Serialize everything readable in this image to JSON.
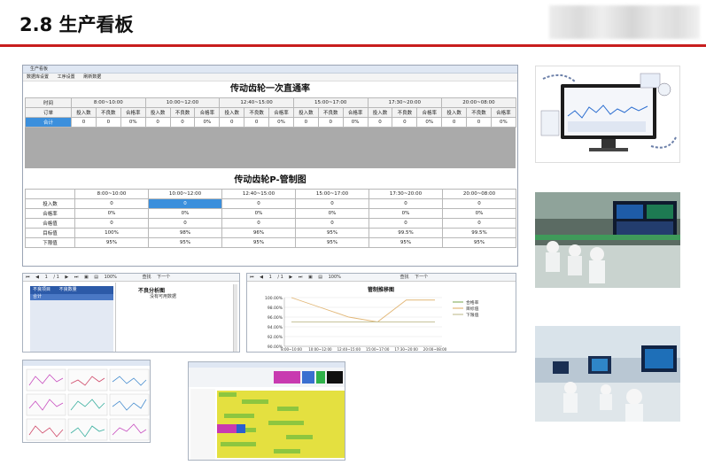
{
  "slide": {
    "title": "2.8 生产看板"
  },
  "app_window": {
    "title": "生产看板",
    "menu": [
      "数据库设置",
      "工序设置",
      "刷新数据"
    ]
  },
  "yield_table": {
    "title": "传动齿轮一次直通率",
    "time_label": "时间",
    "order_label": "订单",
    "total_label": "合计",
    "periods": [
      "8:00~10:00",
      "10:00~12:00",
      "12:40~15:00",
      "15:00~17:00",
      "17:30~20:00",
      "20:00~08:00"
    ],
    "sub_columns": [
      "投入数",
      "不良数",
      "合格率"
    ],
    "total_row": [
      "0",
      "0",
      "0%",
      "0",
      "0",
      "0%",
      "0",
      "0",
      "0%",
      "0",
      "0",
      "0%",
      "0",
      "0",
      "0%",
      "0",
      "0",
      "0%"
    ]
  },
  "p_chart_table": {
    "title": "传动齿轮P-管制图",
    "periods": [
      "8:00~10:00",
      "10:00~12:00",
      "12:40~15:00",
      "15:00~17:00",
      "17:30~20:00",
      "20:00~08:00"
    ],
    "rows": [
      {
        "label": "投入数",
        "values": [
          "0",
          "0",
          "0",
          "0",
          "0",
          "0"
        ]
      },
      {
        "label": "合格率",
        "values": [
          "0%",
          "0%",
          "0%",
          "0%",
          "0%",
          "0%"
        ]
      },
      {
        "label": "合格值",
        "values": [
          "0",
          "0",
          "0",
          "0",
          "0",
          "0"
        ]
      },
      {
        "label": "目标值",
        "values": [
          "100%",
          "98%",
          "96%",
          "95%",
          "99.5%",
          "99.5%"
        ]
      },
      {
        "label": "下限值",
        "values": [
          "95%",
          "95%",
          "95%",
          "95%",
          "95%",
          "95%"
        ]
      }
    ]
  },
  "report_left": {
    "page": "1",
    "pages": "/ 1",
    "zoom": "100%",
    "find": "查找",
    "next": "下一个",
    "col_defect_item": "不良项目",
    "col_defect_count": "不良数量",
    "total_label": "合计",
    "analysis_title": "不良分析图",
    "analysis_empty": "没有可用数据"
  },
  "report_right": {
    "page": "1",
    "pages": "/ 1",
    "zoom": "100%",
    "find": "查找",
    "next": "下一个"
  },
  "chart_data": {
    "type": "line",
    "title": "管制推移图",
    "categories": [
      "8:00~10:00",
      "10:00~12:00",
      "12:40~15:00",
      "15:00~17:00",
      "17:30~20:00",
      "20:00~08:00"
    ],
    "series": [
      {
        "name": "合格率",
        "values": [
          null,
          null,
          null,
          null,
          null,
          null
        ],
        "color": "#8fb36b"
      },
      {
        "name": "目标值",
        "values": [
          100,
          98,
          96,
          95,
          99.5,
          99.5
        ],
        "color": "#e2b777"
      },
      {
        "name": "下限值",
        "values": [
          95,
          95,
          95,
          95,
          95,
          95
        ],
        "color": "#c6c39a"
      }
    ],
    "ylim": [
      90,
      100
    ],
    "yticks": [
      "100.00%",
      "98.00%",
      "96.00%",
      "94.00%",
      "92.00%",
      "90.00%"
    ],
    "grid": true,
    "legend": "right"
  },
  "colors": {
    "accent_red": "#c81e1e",
    "selected_cell": "#3b8fdc",
    "header_blue": "#2c5aa8"
  }
}
